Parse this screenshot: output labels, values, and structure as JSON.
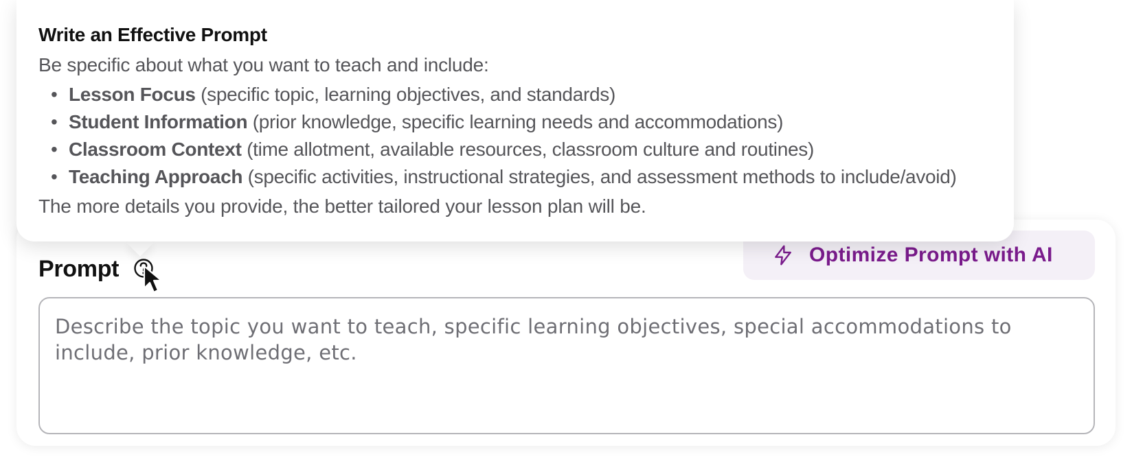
{
  "tooltip": {
    "title": "Write an Effective Prompt",
    "intro": "Be specific about what you want to teach and include:",
    "items": [
      {
        "term": "Lesson Focus",
        "detail": " (specific topic, learning objectives, and standards)"
      },
      {
        "term": "Student Information",
        "detail": " (prior knowledge, specific learning needs and accommodations)"
      },
      {
        "term": "Classroom Context",
        "detail": " (time allotment, available resources, classroom culture and routines)"
      },
      {
        "term": "Teaching Approach",
        "detail": " (specific activities, instructional strategies, and assessment methods to include/avoid)"
      }
    ],
    "outro": "The more details you provide, the better tailored your lesson plan will be."
  },
  "prompt": {
    "label": "Prompt",
    "help_icon": "question-circle-icon",
    "placeholder": "Describe the topic you want to teach, specific learning objectives, special accommodations to include, prior knowledge, etc.",
    "value": ""
  },
  "optimize_button": {
    "label": "Optimize Prompt with AI",
    "icon": "lightning-bolt-icon",
    "color": "#7a1b8c",
    "background": "#f4f0f7"
  },
  "cursor": {
    "icon": "mouse-pointer-icon"
  }
}
